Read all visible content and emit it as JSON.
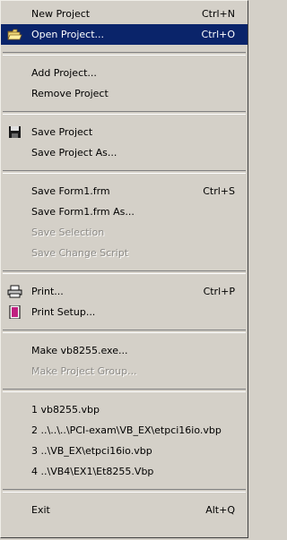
{
  "menu": {
    "groups": [
      [
        {
          "label": "New Project",
          "shortcut": "Ctrl+N"
        },
        {
          "label": "Open Project...",
          "shortcut": "Ctrl+O",
          "selected": true,
          "icon": "open-folder-icon"
        }
      ],
      [
        {
          "label": "Add Project..."
        },
        {
          "label": "Remove Project"
        }
      ],
      [
        {
          "label": "Save Project",
          "icon": "floppy-disk-icon"
        },
        {
          "label": "Save Project As..."
        }
      ],
      [
        {
          "label": "Save Form1.frm",
          "shortcut": "Ctrl+S"
        },
        {
          "label": "Save Form1.frm As..."
        },
        {
          "label": "Save Selection",
          "disabled": true
        },
        {
          "label": "Save Change Script",
          "disabled": true
        }
      ],
      [
        {
          "label": "Print...",
          "shortcut": "Ctrl+P",
          "icon": "printer-icon"
        },
        {
          "label": "Print Setup...",
          "icon": "page-setup-icon"
        }
      ],
      [
        {
          "label": "Make vb8255.exe..."
        },
        {
          "label": "Make Project Group...",
          "disabled": true
        }
      ],
      [
        {
          "label": "1 vb8255.vbp"
        },
        {
          "label": "2 ..\\..\\..\\PCI-exam\\VB_EX\\etpci16io.vbp"
        },
        {
          "label": "3 ..\\VB_EX\\etpci16io.vbp"
        },
        {
          "label": "4 ..\\VB4\\EX1\\Et8255.Vbp"
        }
      ],
      [
        {
          "label": "Exit",
          "shortcut": "Alt+Q"
        }
      ]
    ]
  },
  "colors": {
    "menu_background": "#d4d0c8",
    "highlight": "#0a246a",
    "disabled_text": "#8c8a86"
  }
}
